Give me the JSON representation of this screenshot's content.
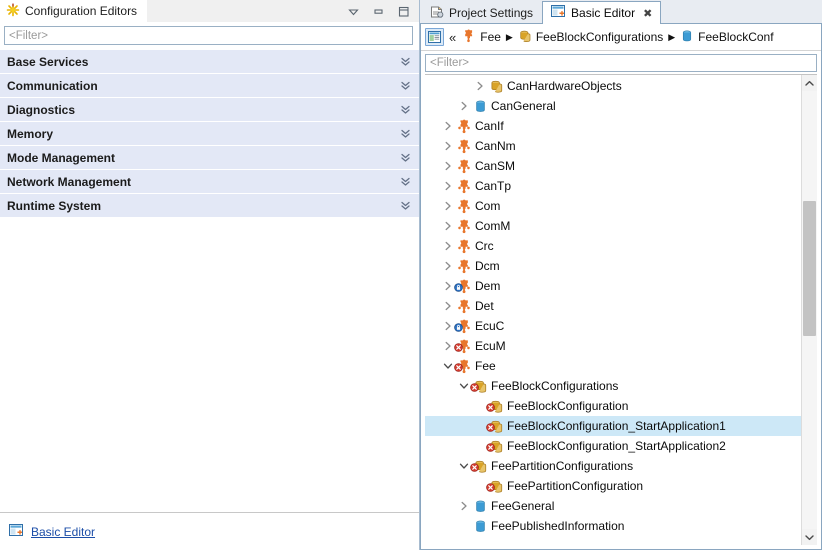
{
  "left_panel": {
    "title": "Configuration Editors",
    "title_icon": "starburst-icon",
    "window_controls": [
      {
        "name": "view-menu-button",
        "icon": "triangle-down-icon"
      },
      {
        "name": "minimize-button",
        "icon": "minimize-icon"
      },
      {
        "name": "maximize-button",
        "icon": "maximize-icon"
      }
    ],
    "filter": {
      "value": "",
      "placeholder": "<Filter>"
    },
    "sections": [
      {
        "label": "Base Services",
        "expand_icon": "double-chevron-down-icon"
      },
      {
        "label": "Communication",
        "expand_icon": "double-chevron-down-icon"
      },
      {
        "label": "Diagnostics",
        "expand_icon": "double-chevron-down-icon"
      },
      {
        "label": "Memory",
        "expand_icon": "double-chevron-down-icon"
      },
      {
        "label": "Mode Management",
        "expand_icon": "double-chevron-down-icon"
      },
      {
        "label": "Network Management",
        "expand_icon": "double-chevron-down-icon"
      },
      {
        "label": "Runtime System",
        "expand_icon": "double-chevron-down-icon"
      }
    ],
    "footer_link": {
      "label": "Basic Editor",
      "icon": "basic-editor-icon"
    }
  },
  "right_panel": {
    "tabs": [
      {
        "label": "Project Settings",
        "icon": "project-settings-icon",
        "active": false,
        "closable": false
      },
      {
        "label": "Basic Editor",
        "icon": "basic-editor-icon",
        "active": true,
        "closable": true,
        "close_glyph": "✖"
      }
    ],
    "breadcrumb": {
      "home_icon": "editor-form-icon",
      "back_glyph": "«",
      "separator_glyph": "▶",
      "items": [
        {
          "label": "Fee",
          "icon": "module-icon"
        },
        {
          "label": "FeeBlockConfigurations",
          "icon": "container-list-icon"
        },
        {
          "label": "FeeBlockConf",
          "icon": "container-icon",
          "truncated": true
        }
      ]
    },
    "filter": {
      "value": "",
      "placeholder": "<Filter>"
    },
    "tree": [
      {
        "label": "CanHardwareObjects",
        "indent": 3,
        "twisty": "collapsed",
        "icon": "container-list-icon",
        "badge": "none",
        "selected": false
      },
      {
        "label": "CanGeneral",
        "indent": 2,
        "twisty": "collapsed",
        "icon": "container-icon",
        "badge": "none",
        "selected": false
      },
      {
        "label": "CanIf",
        "indent": 1,
        "twisty": "collapsed",
        "icon": "module-icon",
        "badge": "none",
        "selected": false
      },
      {
        "label": "CanNm",
        "indent": 1,
        "twisty": "collapsed",
        "icon": "module-icon",
        "badge": "none",
        "selected": false
      },
      {
        "label": "CanSM",
        "indent": 1,
        "twisty": "collapsed",
        "icon": "module-icon",
        "badge": "none",
        "selected": false
      },
      {
        "label": "CanTp",
        "indent": 1,
        "twisty": "collapsed",
        "icon": "module-icon",
        "badge": "none",
        "selected": false
      },
      {
        "label": "Com",
        "indent": 1,
        "twisty": "collapsed",
        "icon": "module-icon",
        "badge": "none",
        "selected": false
      },
      {
        "label": "ComM",
        "indent": 1,
        "twisty": "collapsed",
        "icon": "module-icon",
        "badge": "none",
        "selected": false
      },
      {
        "label": "Crc",
        "indent": 1,
        "twisty": "collapsed",
        "icon": "module-icon",
        "badge": "none",
        "selected": false
      },
      {
        "label": "Dcm",
        "indent": 1,
        "twisty": "collapsed",
        "icon": "module-icon",
        "badge": "none",
        "selected": false
      },
      {
        "label": "Dem",
        "indent": 1,
        "twisty": "collapsed",
        "icon": "module-icon",
        "badge": "lock",
        "selected": false
      },
      {
        "label": "Det",
        "indent": 1,
        "twisty": "collapsed",
        "icon": "module-icon",
        "badge": "none",
        "selected": false
      },
      {
        "label": "EcuC",
        "indent": 1,
        "twisty": "collapsed",
        "icon": "module-icon",
        "badge": "lock",
        "selected": false
      },
      {
        "label": "EcuM",
        "indent": 1,
        "twisty": "collapsed",
        "icon": "module-icon",
        "badge": "error",
        "selected": false
      },
      {
        "label": "Fee",
        "indent": 1,
        "twisty": "expanded",
        "icon": "module-icon",
        "badge": "error",
        "selected": false
      },
      {
        "label": "FeeBlockConfigurations",
        "indent": 2,
        "twisty": "expanded",
        "icon": "container-list-icon",
        "badge": "error",
        "selected": false
      },
      {
        "label": "FeeBlockConfiguration",
        "indent": 3,
        "twisty": "none",
        "icon": "container-list-icon",
        "badge": "error",
        "selected": false
      },
      {
        "label": "FeeBlockConfiguration_StartApplication1",
        "indent": 3,
        "twisty": "none",
        "icon": "container-list-icon",
        "badge": "error",
        "selected": true
      },
      {
        "label": "FeeBlockConfiguration_StartApplication2",
        "indent": 3,
        "twisty": "none",
        "icon": "container-list-icon",
        "badge": "error",
        "selected": false
      },
      {
        "label": "FeePartitionConfigurations",
        "indent": 2,
        "twisty": "expanded",
        "icon": "container-list-icon",
        "badge": "error",
        "selected": false
      },
      {
        "label": "FeePartitionConfiguration",
        "indent": 3,
        "twisty": "none",
        "icon": "container-list-icon",
        "badge": "error",
        "selected": false
      },
      {
        "label": "FeeGeneral",
        "indent": 2,
        "twisty": "collapsed",
        "icon": "container-icon",
        "badge": "none",
        "selected": false
      },
      {
        "label": "FeePublishedInformation",
        "indent": 2,
        "twisty": "none",
        "icon": "container-icon",
        "badge": "none",
        "selected": false
      }
    ],
    "scrollbar": {
      "up_glyph": "˄",
      "down_glyph": "˅",
      "thumb_top_pct": 25,
      "thumb_height_pct": 31
    }
  },
  "colors": {
    "selection": "#cde8f7",
    "section_header": "#e3e8f6",
    "link": "#1c4ea8",
    "module_orange": "#e8762c",
    "container_blue": "#3c9bd4",
    "container_gold": "#d9a327",
    "error_red": "#d23a2e",
    "lock_blue": "#2c6fbf"
  }
}
